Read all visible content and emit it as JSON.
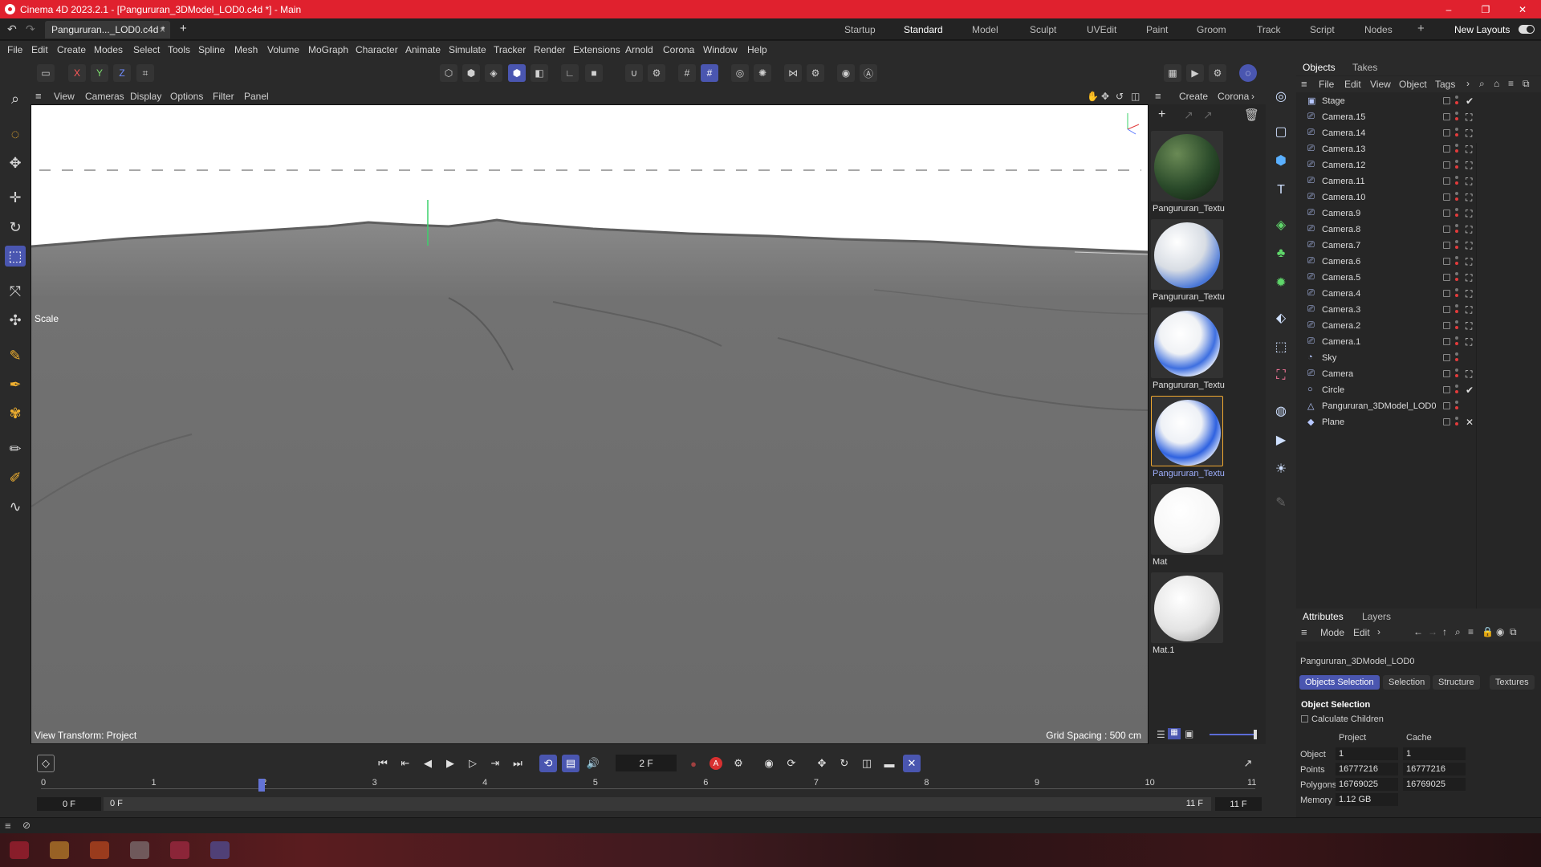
{
  "window": {
    "title": "Cinema 4D 2023.2.1 - [Pangururan_3DModel_LOD0.c4d *] - Main",
    "minimize": "–",
    "restore": "❐",
    "close": "✕"
  },
  "tabs": {
    "document": "Pangururan..._LOD0.c4d *",
    "close": "×",
    "add": "+",
    "layouts": [
      "Startup",
      "Standard",
      "Model",
      "Sculpt",
      "UVEdit",
      "Paint",
      "Groom",
      "Track",
      "Script",
      "Nodes"
    ],
    "active_layout": "Standard",
    "new_layouts": "New Layouts"
  },
  "menu": [
    "File",
    "Edit",
    "Create",
    "Modes",
    "Select",
    "Tools",
    "Spline",
    "Mesh",
    "Volume",
    "MoGraph",
    "Character",
    "Animate",
    "Simulate",
    "Tracker",
    "Render",
    "Extensions",
    "Arnold",
    "Corona",
    "Window",
    "Help"
  ],
  "axis_lock": {
    "x": "X",
    "y": "Y",
    "z": "Z"
  },
  "viewport": {
    "menu": [
      "View",
      "Cameras",
      "Display",
      "Options",
      "Filter",
      "Panel"
    ],
    "scale_label": "Scale",
    "view_transform": "View Transform: Project",
    "grid_spacing": "Grid Spacing : 500 cm",
    "colors": {
      "sky": "#ffffff",
      "terrain": "#6c6c6c",
      "axis_y": "#3bd16a"
    }
  },
  "materials": {
    "menu": [
      "Create",
      "Corona"
    ],
    "items": [
      {
        "name": "Pangururan_Textu",
        "kind": "terrain"
      },
      {
        "name": "Pangururan_Textu",
        "kind": "blue-white"
      },
      {
        "name": "Pangururan_Textu",
        "kind": "blue-white"
      },
      {
        "name": "Pangururan_Textu",
        "kind": "blue-white",
        "selected": true
      },
      {
        "name": "Mat",
        "kind": "white"
      },
      {
        "name": "Mat.1",
        "kind": "white-matte"
      }
    ]
  },
  "objects": {
    "tabs": [
      "Objects",
      "Takes"
    ],
    "menu": [
      "File",
      "Edit",
      "View",
      "Object",
      "Tags"
    ],
    "items": [
      {
        "name": "Stage",
        "icon": "stage-icon",
        "tag": "✔"
      },
      {
        "name": "Camera.15",
        "icon": "camera-icon",
        "tag": "⛶"
      },
      {
        "name": "Camera.14",
        "icon": "camera-icon",
        "tag": "⛶"
      },
      {
        "name": "Camera.13",
        "icon": "camera-icon",
        "tag": "⛶"
      },
      {
        "name": "Camera.12",
        "icon": "camera-icon",
        "tag": "⛶"
      },
      {
        "name": "Camera.11",
        "icon": "camera-icon",
        "tag": "⛶"
      },
      {
        "name": "Camera.10",
        "icon": "camera-icon",
        "tag": "⛶"
      },
      {
        "name": "Camera.9",
        "icon": "camera-icon",
        "tag": "⛶"
      },
      {
        "name": "Camera.8",
        "icon": "camera-icon",
        "tag": "⛶"
      },
      {
        "name": "Camera.7",
        "icon": "camera-icon",
        "tag": "⛶"
      },
      {
        "name": "Camera.6",
        "icon": "camera-icon",
        "tag": "⛶"
      },
      {
        "name": "Camera.5",
        "icon": "camera-icon",
        "tag": "⛶"
      },
      {
        "name": "Camera.4",
        "icon": "camera-icon",
        "tag": "⛶"
      },
      {
        "name": "Camera.3",
        "icon": "camera-icon",
        "tag": "⛶"
      },
      {
        "name": "Camera.2",
        "icon": "camera-icon",
        "tag": "⛶"
      },
      {
        "name": "Camera.1",
        "icon": "camera-icon",
        "tag": "⛶"
      },
      {
        "name": "Sky",
        "icon": "sky-icon",
        "tag": ""
      },
      {
        "name": "Camera",
        "icon": "camera-icon",
        "tag": "⛶"
      },
      {
        "name": "Circle",
        "icon": "circle-icon",
        "tag": "✔"
      },
      {
        "name": "Pangururan_3DModel_LOD0",
        "icon": "polygon-object-icon",
        "tag": ""
      },
      {
        "name": "Plane",
        "icon": "plane-icon",
        "tag": "✕"
      }
    ]
  },
  "attributes": {
    "tabs": [
      "Attributes",
      "Layers"
    ],
    "menu": [
      "Mode",
      "Edit"
    ],
    "object_name": "Pangururan_3DModel_LOD0",
    "subtabs": [
      "Objects Selection",
      "Selection",
      "Structure",
      "Textures"
    ],
    "active_subtab": "Objects Selection",
    "section": "Object Selection",
    "calculate_children": "Calculate Children",
    "columns": [
      "Project",
      "Cache"
    ],
    "rows": [
      {
        "label": "Object",
        "project": "1",
        "cache": "1"
      },
      {
        "label": "Points",
        "project": "16777216",
        "cache": "16777216"
      },
      {
        "label": "Polygons",
        "project": "16769025",
        "cache": "16769025"
      },
      {
        "label": "Memory",
        "project": "1.12 GB",
        "cache": ""
      }
    ]
  },
  "timeline": {
    "current_frame": "2 F",
    "current_frame_value": 2,
    "ruler": [
      "0",
      "1",
      "2",
      "3",
      "4",
      "5",
      "6",
      "7",
      "8",
      "9",
      "10",
      "11"
    ],
    "start": "0 F",
    "range_start": "0 F",
    "range_end": "11 F",
    "end": "11 F"
  }
}
